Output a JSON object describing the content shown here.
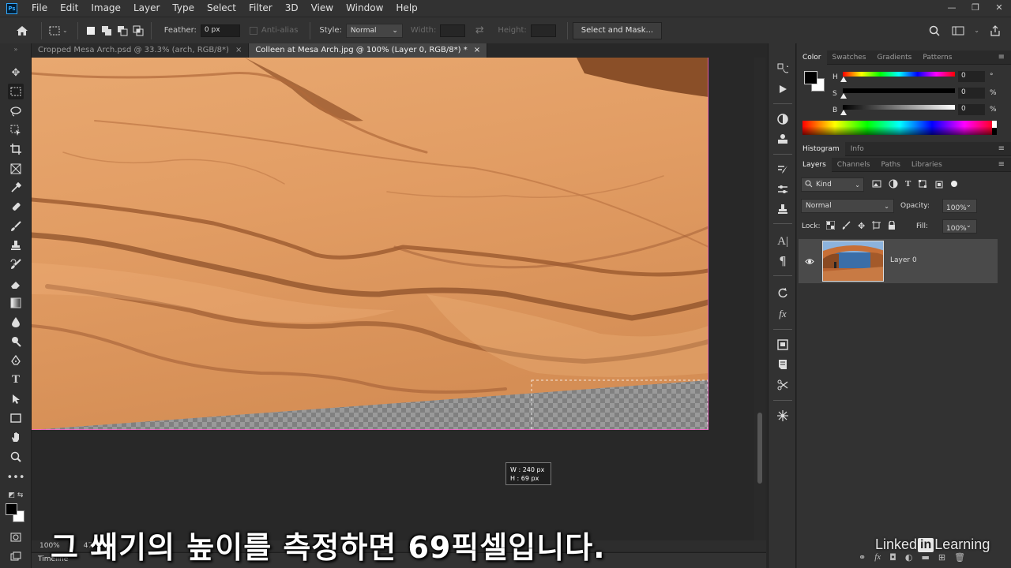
{
  "app": {
    "logo": "Ps"
  },
  "menu": [
    "File",
    "Edit",
    "Image",
    "Layer",
    "Type",
    "Select",
    "Filter",
    "3D",
    "View",
    "Window",
    "Help"
  ],
  "window_controls": {
    "minimize": "—",
    "restore": "❐",
    "close": "✕"
  },
  "options": {
    "feather_label": "Feather:",
    "feather_value": "0 px",
    "antialias_label": "Anti-alias",
    "style_label": "Style:",
    "style_value": "Normal",
    "width_label": "Width:",
    "height_label": "Height:",
    "select_mask_label": "Select and Mask..."
  },
  "doc_tabs": [
    {
      "title": "Cropped Mesa Arch.psd @ 33.3% (arch, RGB/8*)",
      "close": "×"
    },
    {
      "title": "Colleen at Mesa Arch.jpg @ 100% (Layer 0, RGB/8*) *",
      "close": "×"
    }
  ],
  "measure": {
    "w_line": "W :  240 px",
    "h_line": "H :    69 px"
  },
  "status": {
    "zoom": "100%",
    "doc_info": "47",
    "timeline_label": "Timeline"
  },
  "color_panel": {
    "tabs": [
      "Color",
      "Swatches",
      "Gradients",
      "Patterns"
    ],
    "h_label": "H",
    "s_label": "S",
    "b_label": "B",
    "h_value": "0",
    "s_value": "0",
    "b_value": "0",
    "h_unit": "°",
    "s_unit": "%",
    "b_unit": "%"
  },
  "histogram_tabs": [
    "Histogram",
    "Info"
  ],
  "layers_panel": {
    "tabs": [
      "Layers",
      "Channels",
      "Paths",
      "Libraries"
    ],
    "kind_label": "Kind",
    "blend_mode": "Normal",
    "opacity_label": "Opacity:",
    "opacity_value": "100%",
    "lock_label": "Lock:",
    "fill_label": "Fill:",
    "fill_value": "100%",
    "layer_name": "Layer 0"
  },
  "caption": "그 쐐기의 높이를 측정하면 69픽셀입니다.",
  "watermark": {
    "pre": "Linked",
    "box": "in",
    "post": " Learning"
  },
  "colors": {
    "selection": "#ff5fcf",
    "foreground": "#000000",
    "background": "#ffffff"
  }
}
